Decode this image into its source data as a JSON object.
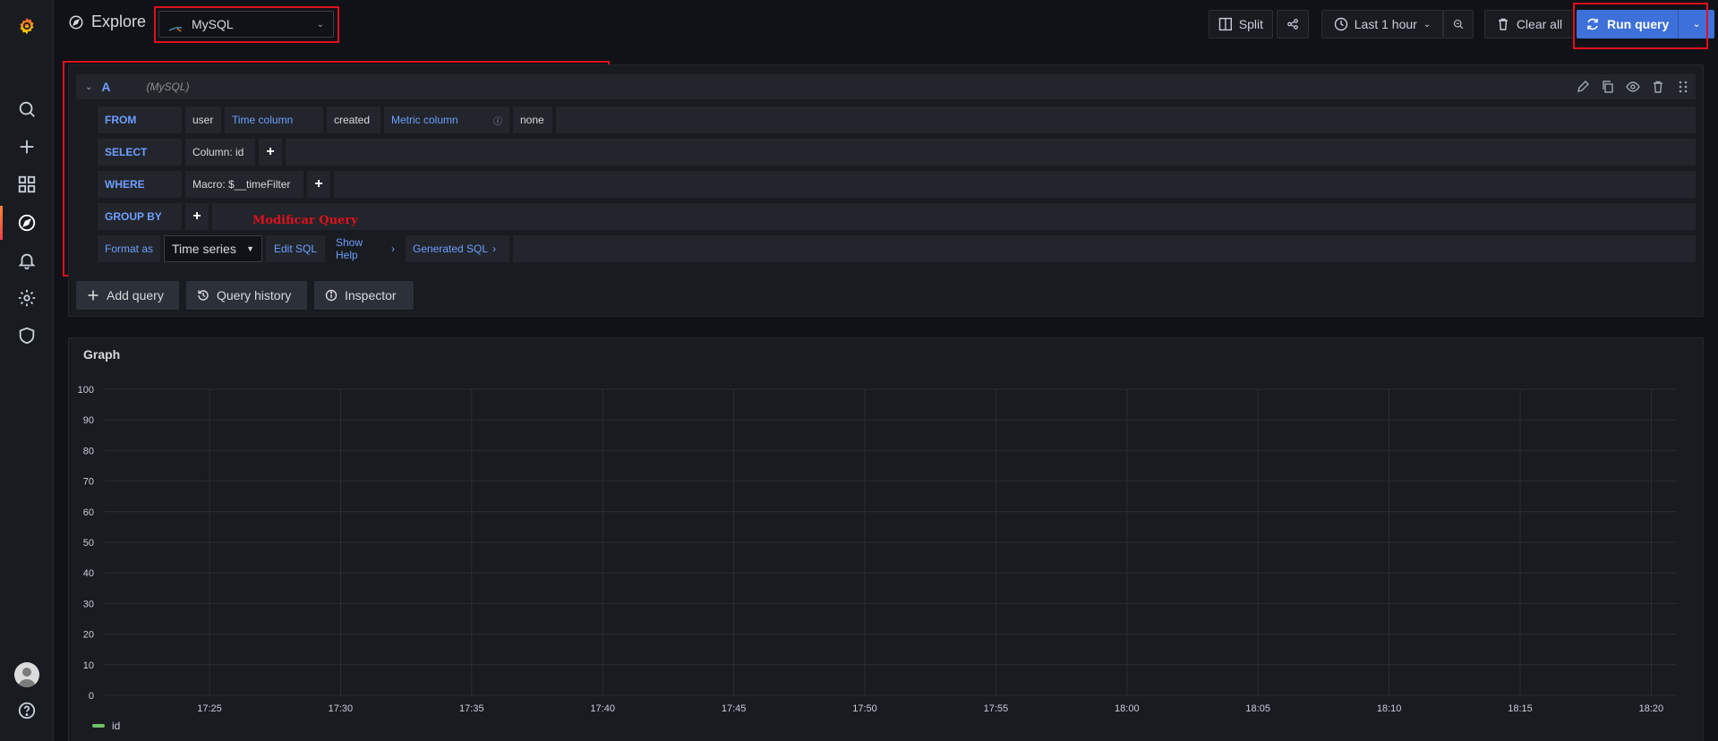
{
  "header": {
    "title": "Explore",
    "datasource": "MySQL",
    "split_label": "Split",
    "time_range": "Last 1 hour",
    "clear_all": "Clear all",
    "run_query": "Run query"
  },
  "query": {
    "letter": "A",
    "datasource_label": "(MySQL)",
    "from": {
      "keyword": "FROM",
      "table": "user",
      "time_column_label": "Time column",
      "time_column_value": "created",
      "metric_column_label": "Metric column",
      "metric_column_value": "none"
    },
    "select": {
      "keyword": "SELECT",
      "column": "Column: id",
      "plus": "+"
    },
    "where": {
      "keyword": "WHERE",
      "macro": "Macro: $__timeFilter",
      "plus": "+"
    },
    "group_by": {
      "keyword": "GROUP BY",
      "plus": "+"
    },
    "format": {
      "label": "Format as",
      "value": "Time series",
      "edit_sql": "Edit SQL",
      "show_help": "Show Help",
      "generated_sql": "Generated SQL"
    },
    "annotation": "Modificar Query"
  },
  "actions": {
    "add_query": "Add query",
    "query_history": "Query history",
    "inspector": "Inspector"
  },
  "graph": {
    "title": "Graph"
  },
  "colors": {
    "accent": "#3d71d9",
    "link": "#6e9fff",
    "series": "#73bf69",
    "highlight": "#e0101d"
  },
  "chart_data": {
    "type": "line",
    "title": "Graph",
    "x": [
      "17:25",
      "17:30",
      "17:35",
      "17:40",
      "17:45",
      "17:50",
      "17:55",
      "18:00",
      "18:05",
      "18:10",
      "18:15",
      "18:20"
    ],
    "ylim": [
      0,
      100
    ],
    "yticks": [
      0,
      10,
      20,
      30,
      40,
      50,
      60,
      70,
      80,
      90,
      100
    ],
    "grid": true,
    "series": [
      {
        "name": "id",
        "values": []
      }
    ],
    "legend": "bottom-left"
  }
}
